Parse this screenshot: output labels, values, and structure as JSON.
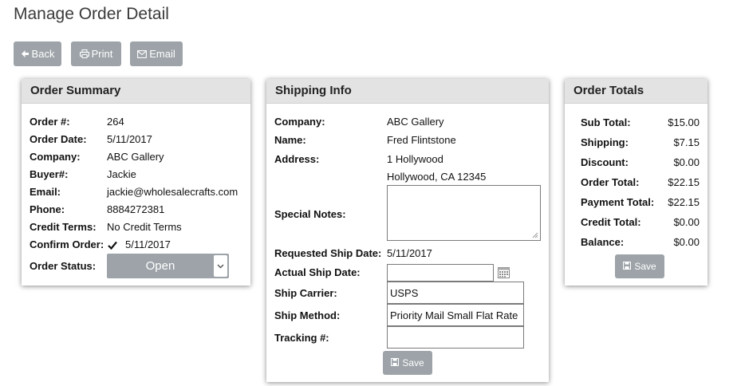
{
  "page": {
    "title": "Manage Order Detail"
  },
  "toolbar": {
    "back_label": "Back",
    "print_label": "Print",
    "email_label": "Email"
  },
  "order_summary": {
    "title": "Order Summary",
    "order_no_label": "Order #:",
    "order_no": "264",
    "order_date_label": "Order Date:",
    "order_date": "5/11/2017",
    "company_label": "Company:",
    "company": "ABC Gallery",
    "buyer_label": "Buyer#:",
    "buyer": "Jackie",
    "email_label": "Email:",
    "email": "jackie@wholesalecrafts.com",
    "phone_label": "Phone:",
    "phone": "8884272381",
    "credit_terms_label": "Credit Terms:",
    "credit_terms": "No Credit Terms",
    "confirm_order_label": "Confirm Order:",
    "confirm_order_date": "5/11/2017",
    "order_status_label": "Order Status:",
    "order_status": "Open"
  },
  "shipping_info": {
    "title": "Shipping Info",
    "company_label": "Company:",
    "company": "ABC Gallery",
    "name_label": "Name:",
    "name": "Fred Flintstone",
    "address_label": "Address:",
    "address_line1": "1 Hollywood",
    "address_line2": "Hollywood, CA 12345",
    "special_notes_label": "Special Notes:",
    "special_notes": "",
    "requested_ship_date_label": "Requested Ship Date:",
    "requested_ship_date": "5/11/2017",
    "actual_ship_date_label": "Actual Ship Date:",
    "actual_ship_date": "",
    "ship_carrier_label": "Ship Carrier:",
    "ship_carrier": "USPS",
    "ship_method_label": "Ship Method:",
    "ship_method": "Priority Mail Small Flat Rate",
    "tracking_label": "Tracking #:",
    "tracking": "",
    "save_label": "Save"
  },
  "order_totals": {
    "title": "Order Totals",
    "rows": [
      {
        "label": "Sub Total:",
        "value": "$15.00"
      },
      {
        "label": "Shipping:",
        "value": "$7.15"
      },
      {
        "label": "Discount:",
        "value": "$0.00"
      },
      {
        "label": "Order Total:",
        "value": "$22.15"
      },
      {
        "label": "Payment Total:",
        "value": "$22.15"
      },
      {
        "label": "Credit Total:",
        "value": "$0.00"
      },
      {
        "label": "Balance:",
        "value": "$0.00"
      }
    ],
    "save_label": "Save"
  },
  "colors": {
    "button_gray": "#9da3a8",
    "panel_header": "#e3e3e3"
  }
}
